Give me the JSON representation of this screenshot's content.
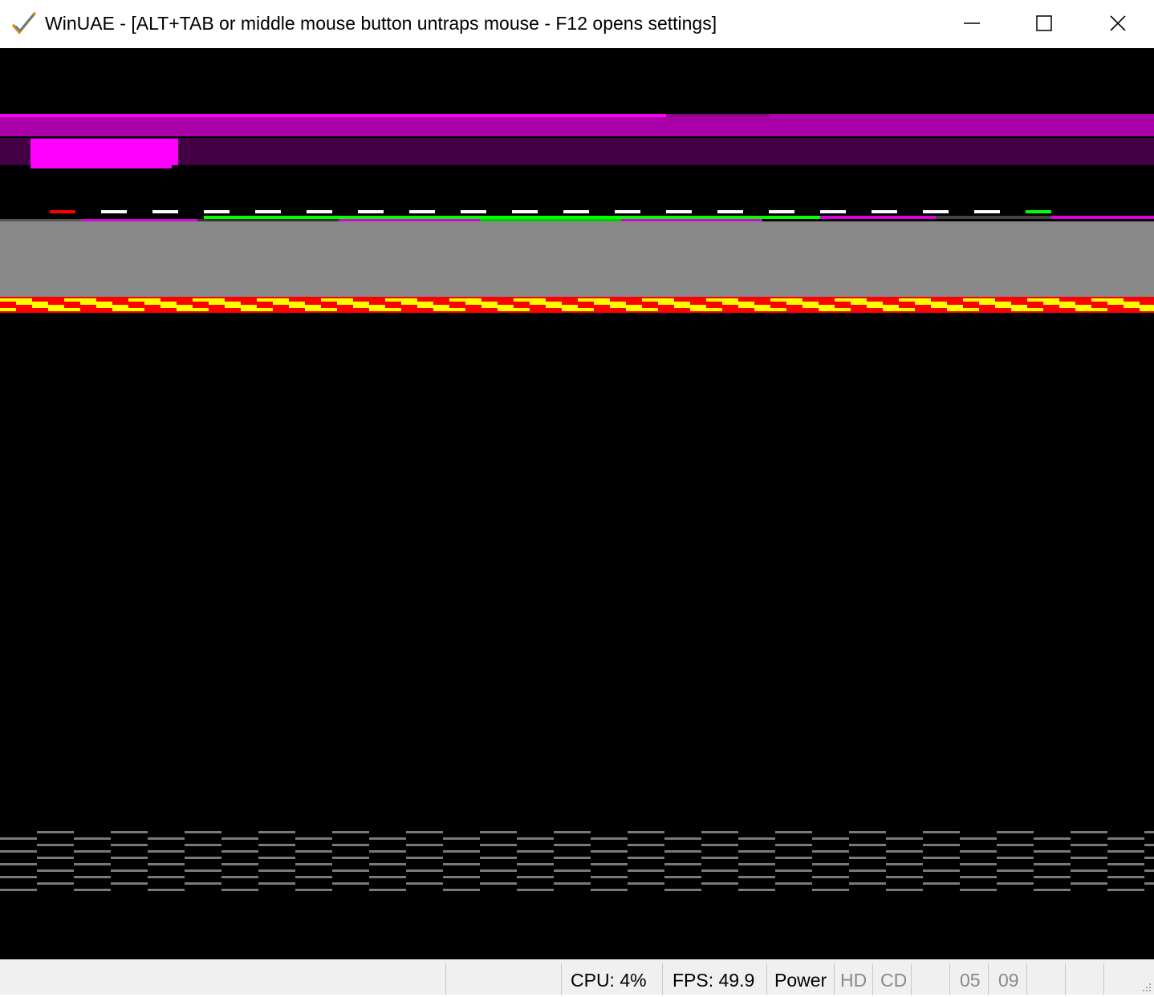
{
  "window": {
    "title": "WinUAE - [ALT+TAB or middle mouse button untraps mouse - F12 opens settings]"
  },
  "titlebar_buttons": [
    "minimize-icon",
    "maximize-icon",
    "close-icon"
  ],
  "statusbar": {
    "cpu": "CPU: 4%",
    "fps": "FPS: 49.9",
    "power": "Power",
    "hd": "HD",
    "cd": "CD",
    "drive0": "05",
    "drive1": "09"
  },
  "colors": {
    "screen_bg": "#000000",
    "magenta": "#ff00ff",
    "dark_magenta": "#aa00aa",
    "deep_purple": "#440044",
    "road_gray": "#888888",
    "kerb_red": "#ff0000",
    "kerb_yellow": "#ffff00",
    "lane_green": "#00ff00",
    "lane_white": "#ffffff",
    "status_bg": "#f0f0f0"
  }
}
